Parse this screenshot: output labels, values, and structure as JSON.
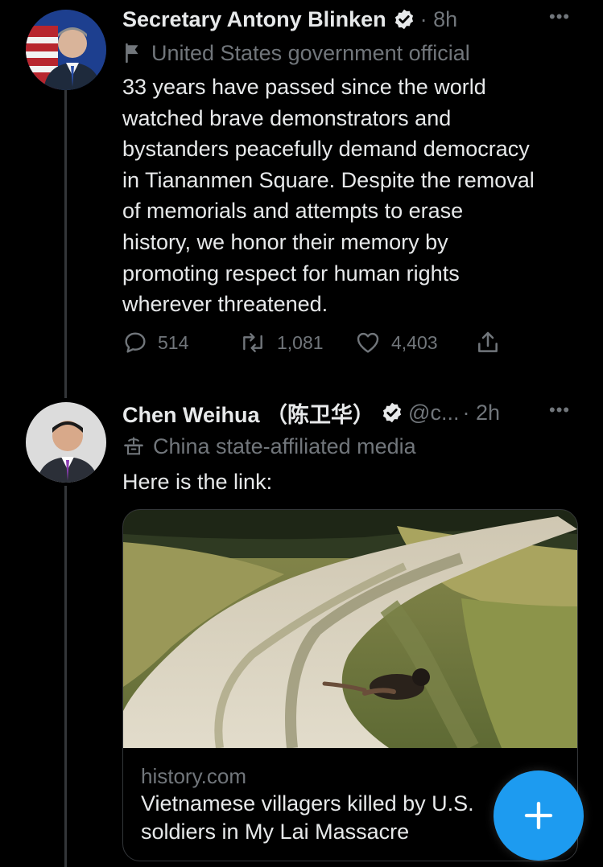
{
  "tweets": [
    {
      "name": "Secretary Antony Blinken",
      "handle": "",
      "time": "· 8h",
      "more": "•••",
      "label": "United States government official",
      "label_icon": "flag-icon",
      "text_lines": [
        "33 years have passed since the world",
        "watched brave demonstrators and",
        "bystanders peacefully demand democracy",
        "in Tiananmen Square. Despite the removal",
        "of memorials and attempts to erase",
        "history, we honor their memory by",
        "promoting respect for human rights",
        "wherever threatened."
      ],
      "replies": "514",
      "retweets": "1,081",
      "likes": "4,403"
    },
    {
      "name": "Chen Weihua （陈卫华）",
      "handle": "@c...",
      "time": "· 2h",
      "more": "•••",
      "label": "China state-affiliated media",
      "label_icon": "podium-icon",
      "text_lines": [
        "Here is the link:"
      ],
      "card": {
        "domain": "history.com",
        "title_lines": [
          "Vietnamese villagers killed by U.S.",
          "soldiers in My Lai Massacre"
        ]
      }
    }
  ],
  "colors": {
    "background": "#000000",
    "text": "#e7e9ea",
    "muted": "#71767b",
    "accent": "#1d9bf0",
    "verified_badge": "#e7e9ea"
  },
  "fab": {
    "icon": "plus-icon"
  }
}
